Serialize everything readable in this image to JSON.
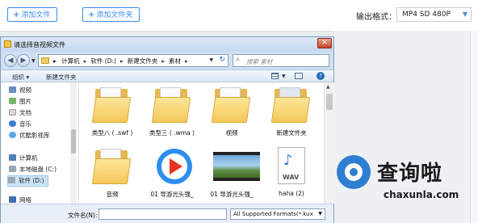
{
  "app": {
    "add_file_label": "添加文件",
    "add_folder_label": "添加文件夹",
    "output_format_label": "输出格式：",
    "output_format_value": "MP4  SD 480P"
  },
  "dialog": {
    "title": "请选择音视频文件",
    "close": "✕",
    "breadcrumbs": [
      "计算机",
      "软件 (D:)",
      "新建文件夹",
      "素材"
    ],
    "search_placeholder": "搜索 素材",
    "toolbar": {
      "organize": "组织 ▾",
      "new_folder": "新建文件夹",
      "help": "?"
    },
    "nav": {
      "items": [
        {
          "label": "视频",
          "icon": "video-library-icon"
        },
        {
          "label": "图片",
          "icon": "pictures-library-icon"
        },
        {
          "label": "文档",
          "icon": "documents-library-icon"
        },
        {
          "label": "音乐",
          "icon": "music-library-icon"
        },
        {
          "label": "优酷影视库",
          "icon": "youku-library-icon"
        },
        {
          "label": "计算机",
          "icon": "computer-icon"
        },
        {
          "label": "本地磁盘 (C:)",
          "icon": "drive-c-icon"
        },
        {
          "label": "软件 (D:)",
          "icon": "drive-d-icon"
        },
        {
          "label": "网络",
          "icon": "network-icon"
        }
      ]
    },
    "files": [
      {
        "name": "类型八 ( .swf )",
        "type": "folder"
      },
      {
        "name": "类型三 ( .wma )",
        "type": "folder"
      },
      {
        "name": "视频",
        "type": "folder"
      },
      {
        "name": "新建文件夹",
        "type": "folder"
      },
      {
        "name": "音频",
        "type": "folder"
      },
      {
        "name": "01 导游光头强_",
        "type": "player"
      },
      {
        "name": "01 导游光头强_",
        "type": "video"
      },
      {
        "name": "haha (2)",
        "type": "wav"
      }
    ],
    "wav_label": "WAV",
    "filename_label": "文件名(N):",
    "filename_value": "",
    "filter_value": "All Supported Formats(*.kux"
  },
  "watermark": {
    "text": "查询啦",
    "domain": "chaxunla.com"
  },
  "colors": {
    "accent": "#3b8cf0",
    "title_bar": "#cfe0f3",
    "folder": "#f4c85a"
  }
}
